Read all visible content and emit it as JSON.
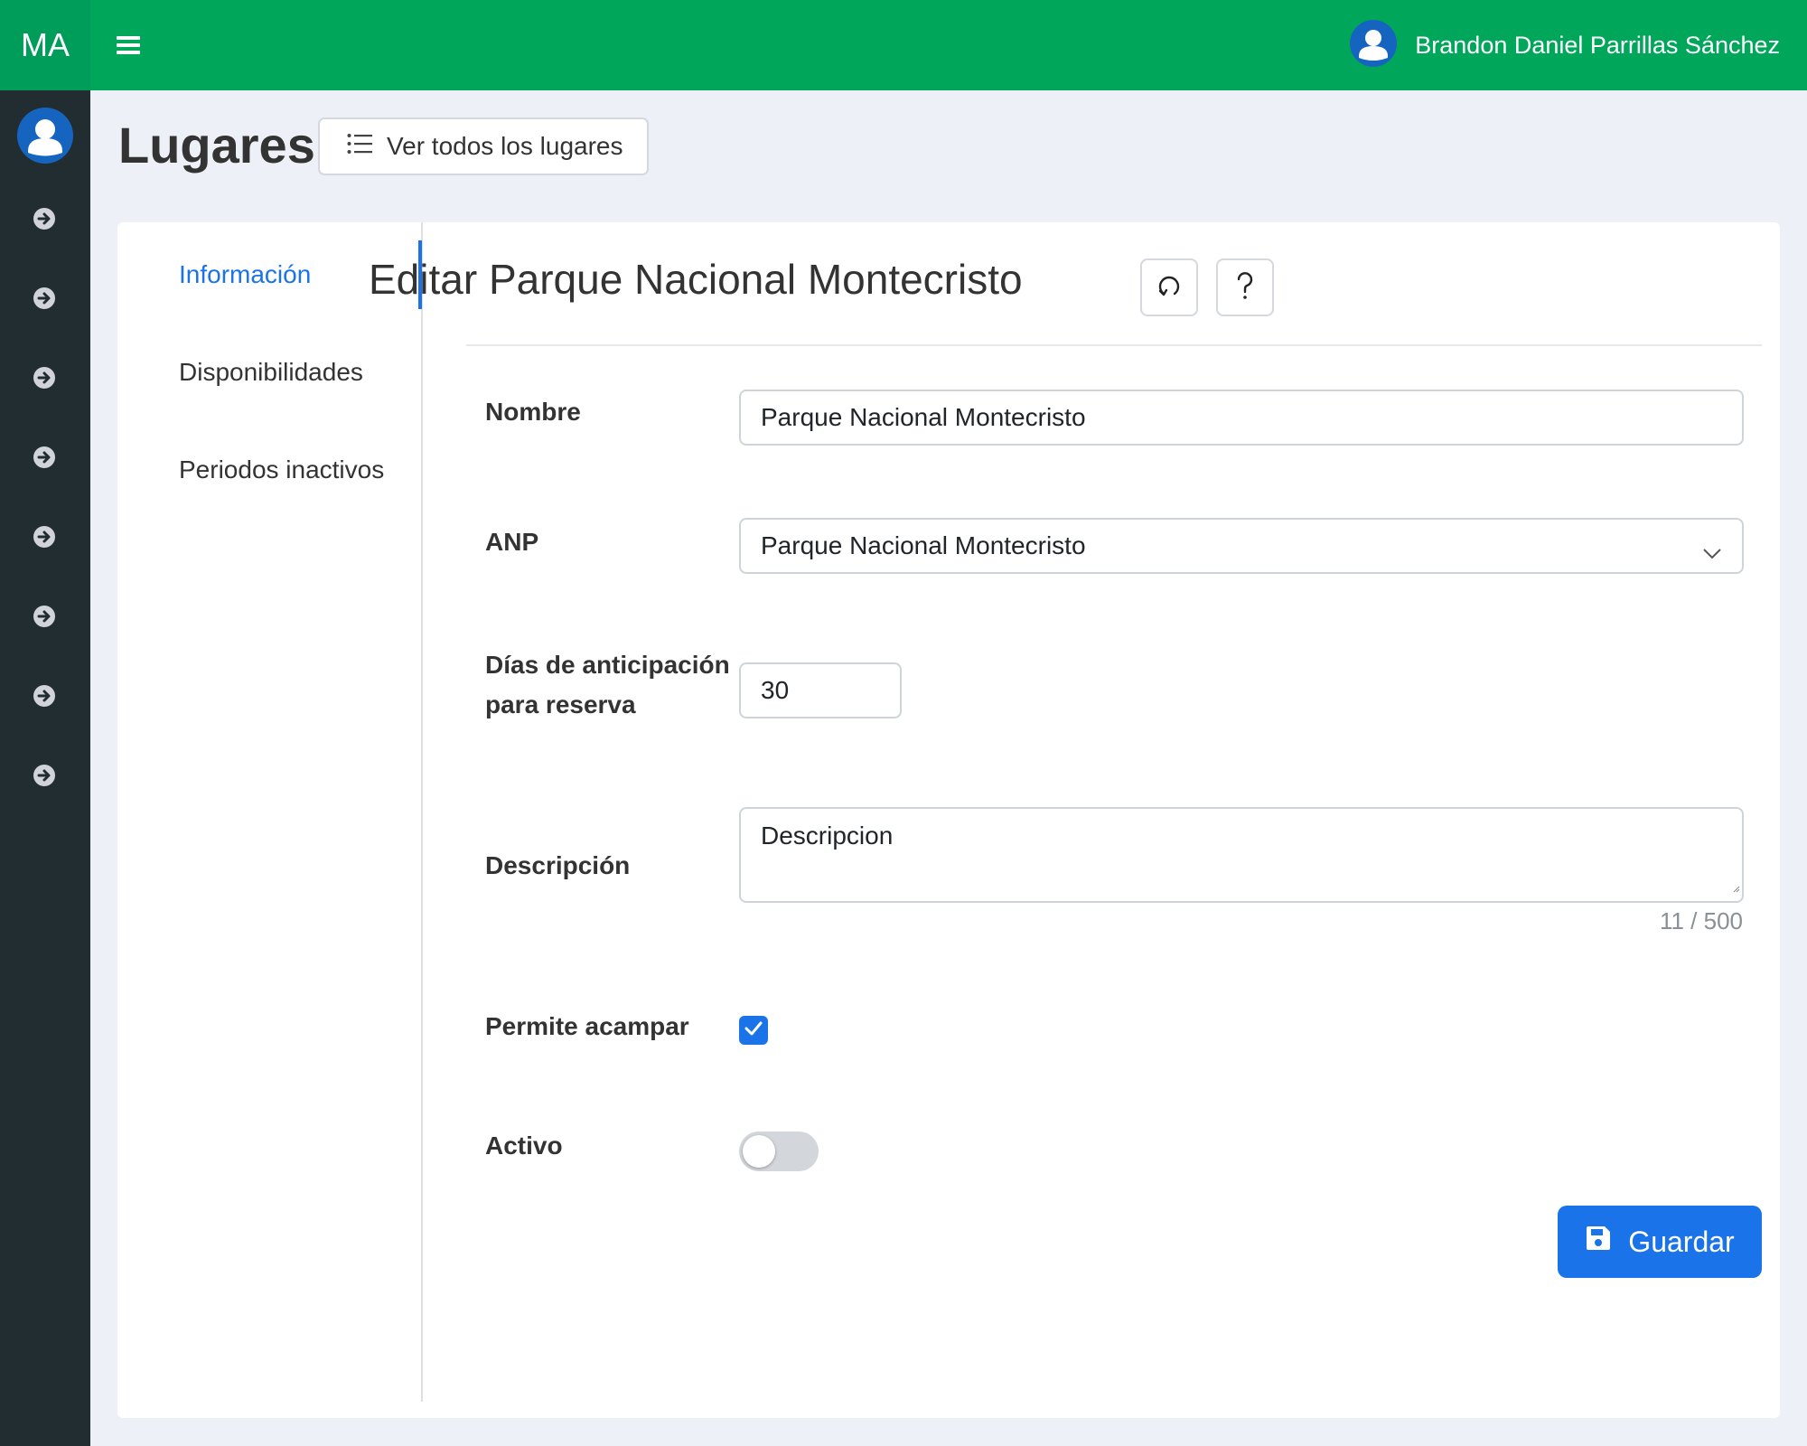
{
  "brand": {
    "text": "MA"
  },
  "topbar": {
    "menu_icon": "hamburger-menu-icon",
    "user_name": "Brandon Daniel Parrillas Sánchez",
    "user_icon": "user-avatar-icon"
  },
  "sidebar": {
    "avatar_icon": "user-avatar-icon",
    "items": [
      {
        "icon": "arrow-circle-right-icon"
      },
      {
        "icon": "arrow-circle-right-icon"
      },
      {
        "icon": "arrow-circle-right-icon"
      },
      {
        "icon": "arrow-circle-right-icon"
      },
      {
        "icon": "arrow-circle-right-icon"
      },
      {
        "icon": "arrow-circle-right-icon"
      },
      {
        "icon": "arrow-circle-right-icon"
      },
      {
        "icon": "arrow-circle-right-icon"
      }
    ]
  },
  "header": {
    "title": "Lugares",
    "view_all_label": "Ver todos los lugares",
    "view_all_icon": "list-icon"
  },
  "tabs": [
    {
      "label": "Información",
      "active": true
    },
    {
      "label": "Disponibilidades",
      "active": false
    },
    {
      "label": "Periodos inactivos",
      "active": false
    }
  ],
  "form": {
    "title": "Editar Parque Nacional Montecristo",
    "refresh_icon": "refresh-icon",
    "help_icon": "help-icon",
    "fields": {
      "nombre": {
        "label": "Nombre",
        "value": "Parque Nacional Montecristo"
      },
      "anp": {
        "label": "ANP",
        "value": "Parque Nacional Montecristo"
      },
      "dias": {
        "label_line1": "Días de anticipación",
        "label_line2": "para reserva",
        "value": "30"
      },
      "descripcion": {
        "label": "Descripción",
        "value": "Descripcion",
        "counter": "11 / 500"
      },
      "acampar": {
        "label": "Permite acampar",
        "checked": true
      },
      "activo": {
        "label": "Activo",
        "on": false
      }
    },
    "save_label": "Guardar",
    "save_icon": "save-icon"
  },
  "colors": {
    "topbar": "#00a65a",
    "sidebar": "#222d32",
    "accent": "#1a73e8",
    "background": "#edf0f6"
  }
}
